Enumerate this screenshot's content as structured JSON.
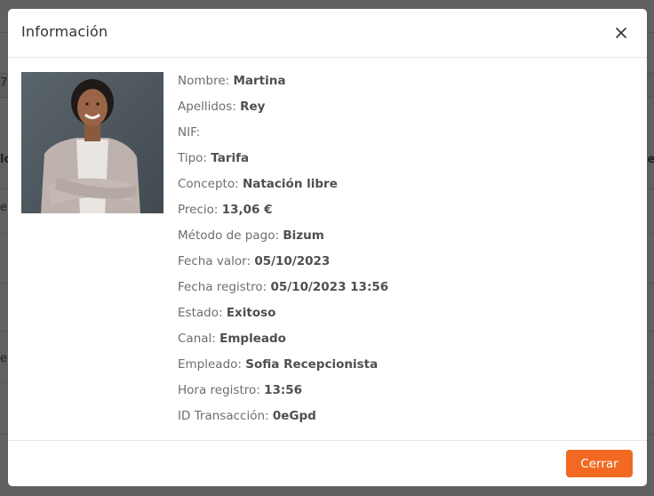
{
  "modal": {
    "title": "Información",
    "close_label": "X",
    "photo_alt": "",
    "fields": [
      {
        "label": "Nombre:",
        "value": "Martina"
      },
      {
        "label": "Apellidos:",
        "value": "Rey"
      },
      {
        "label": "NIF:",
        "value": ""
      },
      {
        "label": "Tipo:",
        "value": "Tarifa"
      },
      {
        "label": "Concepto:",
        "value": "Natación libre"
      },
      {
        "label": "Precio:",
        "value": "13,06 €"
      },
      {
        "label": "Método de pago:",
        "value": "Bizum"
      },
      {
        "label": "Fecha valor:",
        "value": "05/10/2023"
      },
      {
        "label": "Fecha registro:",
        "value": "05/10/2023 13:56"
      },
      {
        "label": "Estado:",
        "value": "Exitoso"
      },
      {
        "label": "Canal:",
        "value": "Empleado"
      },
      {
        "label": "Empleado:",
        "value": "Sofia Recepcionista"
      },
      {
        "label": "Hora registro:",
        "value": "13:56"
      },
      {
        "label": "ID Transacción:",
        "value": "0eGpd"
      }
    ],
    "close_button_label": "Cerrar"
  },
  "background": {
    "fragments": [
      "7",
      "lo",
      "le",
      "e",
      "e"
    ]
  },
  "colors": {
    "accent": "#f26a21",
    "overlay": "#5b5b5b"
  },
  "icons": {
    "close": "close-icon"
  }
}
